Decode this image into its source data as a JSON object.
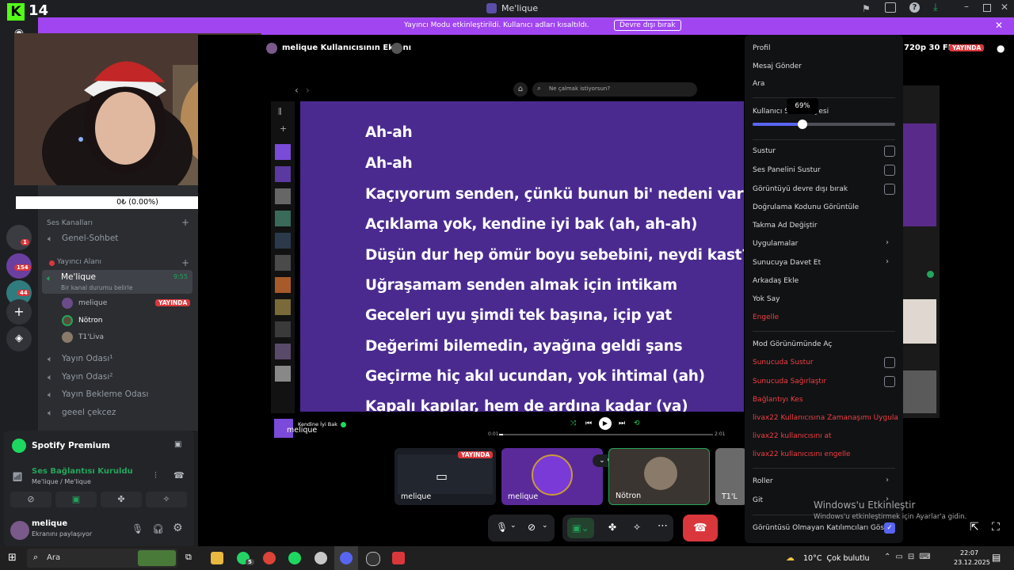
{
  "window": {
    "title": "Me'lique"
  },
  "banner": {
    "message": "Yayıncı Modu etkinleştirildi. Kullanıcı adları kısaltıldı.",
    "button": "Devre dışı bırak"
  },
  "overlay": {
    "logo": "14",
    "donation": "0₺ (0.00%)"
  },
  "rail": {
    "badges": [
      "1",
      "154",
      "44"
    ]
  },
  "channels": {
    "voice_category": "Ses Kanalları",
    "general": "Genel-Sohbet",
    "streamer_category": "Yayıncı Alanı",
    "active_channel": {
      "name": "Me'lique",
      "time": "9:55",
      "status": "Bir kanal durumu belirle"
    },
    "members": [
      {
        "name": "melique",
        "badge": "YAYINDA"
      },
      {
        "name": "Nötron"
      },
      {
        "name": "T1'Liva"
      }
    ],
    "others": [
      "Yayın Odası¹",
      "Yayın Odası²",
      "Yayın Bekleme Odası",
      "geeel çekcez"
    ]
  },
  "spotify": {
    "title": "Spotify Premium"
  },
  "voice": {
    "status": "Ses Bağlantısı Kuruldu",
    "channel": "Me'lique / Me'lique"
  },
  "user": {
    "name": "melique",
    "status": "Ekranını paylaşıyor"
  },
  "stream": {
    "header": "melique Kullanıcısının Ekranı",
    "quality": "720p 30 FPS",
    "live": "YAYINDA",
    "search_placeholder": "Ne çalmak istiyorsun?",
    "now_playing": "Kendine İyi Bak",
    "time_start": "0:01",
    "time_end": "2:01",
    "lyrics": [
      "Ah-ah",
      "Ah-ah",
      "Kaçıyorum senden, çünkü bunun bi' nedeni var",
      "Açıklama yok, kendine iyi bak (ah, ah-ah)",
      "Düşün dur hep ömür boyu sebebini, neydi kast?",
      "Uğraşamam senden almak için intikam",
      "Geceleri uyu şimdi tek başına, içip yat",
      "Değerimi bilemedin, ayağına geldi şans",
      "Geçirme hiç akıl ucundan, yok ihtimal (ah)",
      "Kapalı kapılar, hem de ardına kadar (ya)"
    ],
    "presenter_label": "melique"
  },
  "tiles": [
    {
      "name": "melique",
      "badge": "YAYINDA"
    },
    {
      "name": "melique"
    },
    {
      "name": "Nötron"
    },
    {
      "name": "T1'L"
    }
  ],
  "menu": {
    "items_top": [
      "Profil",
      "Mesaj Gönder",
      "Ara"
    ],
    "volume_label": "Kullanıcı Ses Seviyesi",
    "volume_value": "69%",
    "volume_level": 0.35,
    "toggles": [
      "Sustur",
      "Ses Panelini Sustur",
      "Görüntüyü devre dışı bırak"
    ],
    "items_mid": [
      "Doğrulama Kodunu Görüntüle",
      "Takma Ad Değiştir",
      "Uygulamalar",
      "Sunucuya Davet Et",
      "Arkadaş Ekle",
      "Yok Say"
    ],
    "block": "Engelle",
    "mod_view": "Mod Görünümünde Aç",
    "mod_red": [
      "Sunucuda Sustur",
      "Sunucuda Sağırlaştır",
      "Bağlantıyı Kes",
      "livax22 Kullanıcısına Zamanaşımı Uygula",
      "livax22 kullanıcısını at",
      "livax22 kullanıcısını engelle"
    ],
    "roles": "Roller",
    "go": "Git",
    "show_nonvideo": "Görüntüsü Olmayan Katılımcıları Göster"
  },
  "watermark": {
    "title": "Windows'u Etkinleştir",
    "subtitle": "Windows'u etkinleştirmek için Ayarlar'a gidin."
  },
  "taskbar": {
    "search": "Ara",
    "whatsapp_badge": "5",
    "weather": "10°C  Çok bulutlu",
    "time": "22:07",
    "date": "23.12.2025"
  },
  "colors": {
    "accent": "#a145f0",
    "danger": "#da373c",
    "online": "#23a55a",
    "lyrics_bg": "#4a2a8f",
    "blurple": "#5865f2"
  }
}
